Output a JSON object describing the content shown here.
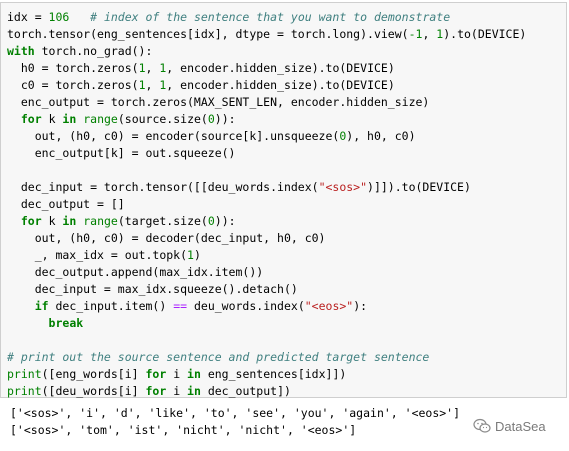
{
  "code_lines": [
    [
      {
        "t": "idx = ",
        "c": "var"
      },
      {
        "t": "106",
        "c": "num"
      },
      {
        "t": "   ",
        "c": "var"
      },
      {
        "t": "# index of the sentence that you want to demonstrate",
        "c": "cm"
      }
    ],
    [
      {
        "t": "torch.tensor(eng_sentences[idx], dtype = torch.long).view(",
        "c": "var"
      },
      {
        "t": "-1",
        "c": "num"
      },
      {
        "t": ", ",
        "c": "var"
      },
      {
        "t": "1",
        "c": "num"
      },
      {
        "t": ").to(DEVICE)",
        "c": "var"
      }
    ],
    [
      {
        "t": "with",
        "c": "kw"
      },
      {
        "t": " torch.no_grad():",
        "c": "var"
      }
    ],
    [
      {
        "t": "  h0 = torch.zeros(",
        "c": "var"
      },
      {
        "t": "1",
        "c": "num"
      },
      {
        "t": ", ",
        "c": "var"
      },
      {
        "t": "1",
        "c": "num"
      },
      {
        "t": ", encoder.hidden_size).to(DEVICE)",
        "c": "var"
      }
    ],
    [
      {
        "t": "  c0 = torch.zeros(",
        "c": "var"
      },
      {
        "t": "1",
        "c": "num"
      },
      {
        "t": ", ",
        "c": "var"
      },
      {
        "t": "1",
        "c": "num"
      },
      {
        "t": ", encoder.hidden_size).to(DEVICE)",
        "c": "var"
      }
    ],
    [
      {
        "t": "  enc_output = torch.zeros(MAX_SENT_LEN, encoder.hidden_size)",
        "c": "var"
      }
    ],
    [
      {
        "t": "  ",
        "c": "var"
      },
      {
        "t": "for",
        "c": "kw"
      },
      {
        "t": " k ",
        "c": "var"
      },
      {
        "t": "in",
        "c": "kw"
      },
      {
        "t": " ",
        "c": "var"
      },
      {
        "t": "range",
        "c": "fn"
      },
      {
        "t": "(source.size(",
        "c": "var"
      },
      {
        "t": "0",
        "c": "num"
      },
      {
        "t": ")):",
        "c": "var"
      }
    ],
    [
      {
        "t": "    out, (h0, c0) = encoder(source[k].unsqueeze(",
        "c": "var"
      },
      {
        "t": "0",
        "c": "num"
      },
      {
        "t": "), h0, c0)",
        "c": "var"
      }
    ],
    [
      {
        "t": "    enc_output[k] = out.squeeze()",
        "c": "var"
      }
    ],
    [
      {
        "t": "",
        "c": "var"
      }
    ],
    [
      {
        "t": "  dec_input = torch.tensor([[deu_words.index(",
        "c": "var"
      },
      {
        "t": "\"<sos>\"",
        "c": "str"
      },
      {
        "t": ")]]).to(DEVICE)",
        "c": "var"
      }
    ],
    [
      {
        "t": "  dec_output = []",
        "c": "var"
      }
    ],
    [
      {
        "t": "  ",
        "c": "var"
      },
      {
        "t": "for",
        "c": "kw"
      },
      {
        "t": " k ",
        "c": "var"
      },
      {
        "t": "in",
        "c": "kw"
      },
      {
        "t": " ",
        "c": "var"
      },
      {
        "t": "range",
        "c": "fn"
      },
      {
        "t": "(target.size(",
        "c": "var"
      },
      {
        "t": "0",
        "c": "num"
      },
      {
        "t": ")):",
        "c": "var"
      }
    ],
    [
      {
        "t": "    out, (h0, c0) = decoder(dec_input, h0, c0)",
        "c": "var"
      }
    ],
    [
      {
        "t": "    _, max_idx = out.topk(",
        "c": "var"
      },
      {
        "t": "1",
        "c": "num"
      },
      {
        "t": ")",
        "c": "var"
      }
    ],
    [
      {
        "t": "    dec_output.append(max_idx.item())",
        "c": "var"
      }
    ],
    [
      {
        "t": "    dec_input = max_idx.squeeze().detach()",
        "c": "var"
      }
    ],
    [
      {
        "t": "    ",
        "c": "var"
      },
      {
        "t": "if",
        "c": "kw"
      },
      {
        "t": " dec_input.item() ",
        "c": "var"
      },
      {
        "t": "==",
        "c": "op"
      },
      {
        "t": " deu_words.index(",
        "c": "var"
      },
      {
        "t": "\"<eos>\"",
        "c": "str"
      },
      {
        "t": "):",
        "c": "var"
      }
    ],
    [
      {
        "t": "      ",
        "c": "var"
      },
      {
        "t": "break",
        "c": "kw"
      }
    ],
    [
      {
        "t": "",
        "c": "var"
      }
    ],
    [
      {
        "t": "# print out the source sentence and predicted target sentence",
        "c": "cm"
      }
    ],
    [
      {
        "t": "print",
        "c": "fn"
      },
      {
        "t": "([eng_words[i] ",
        "c": "var"
      },
      {
        "t": "for",
        "c": "kw"
      },
      {
        "t": " i ",
        "c": "var"
      },
      {
        "t": "in",
        "c": "kw"
      },
      {
        "t": " eng_sentences[idx]])",
        "c": "var"
      }
    ],
    [
      {
        "t": "print",
        "c": "fn"
      },
      {
        "t": "([deu_words[i] ",
        "c": "var"
      },
      {
        "t": "for",
        "c": "kw"
      },
      {
        "t": " i ",
        "c": "var"
      },
      {
        "t": "in",
        "c": "kw"
      },
      {
        "t": " dec_output])",
        "c": "var"
      }
    ]
  ],
  "output_lines": [
    "['<sos>', 'i', 'd', 'like', 'to', 'see', 'you', 'again', '<eos>']",
    "['<sos>', 'tom', 'ist', 'nicht', 'nicht', '<eos>']"
  ],
  "watermark": {
    "text": "DataSea",
    "icon": "wechat-icon"
  }
}
